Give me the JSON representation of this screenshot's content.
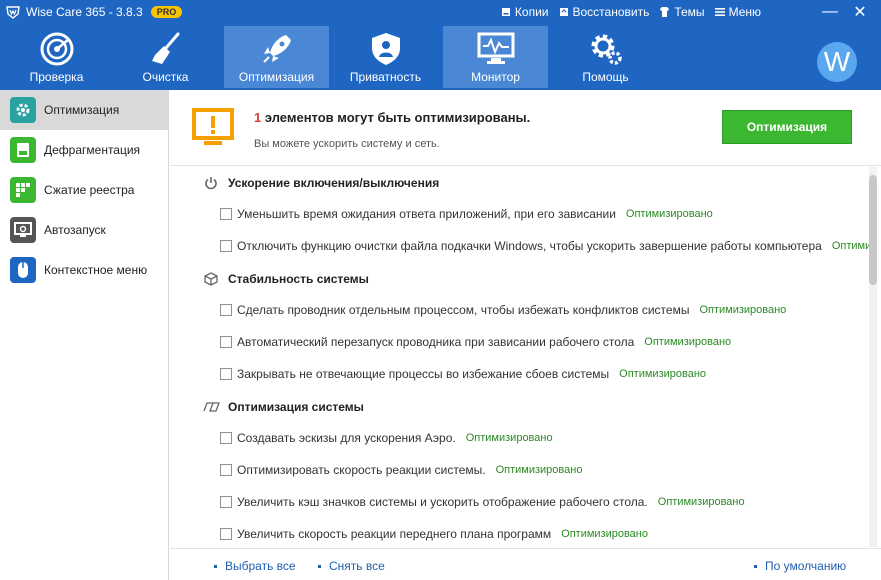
{
  "app": {
    "title": "Wise Care 365 - 3.8.3",
    "badge": "PRO",
    "menu": [
      {
        "label": "Копии",
        "icon": "disk-icon"
      },
      {
        "label": "Восстановить",
        "icon": "restore-icon"
      },
      {
        "label": "Темы",
        "icon": "shirt-icon"
      },
      {
        "label": "Меню",
        "icon": "menu-icon"
      }
    ],
    "window_controls": {
      "minimize": "—",
      "close": "✕"
    },
    "avatar_letter": "W"
  },
  "toolbar": [
    {
      "label": "Проверка",
      "icon": "radar-icon",
      "active": false
    },
    {
      "label": "Очистка",
      "icon": "broom-icon",
      "active": false
    },
    {
      "label": "Оптимизация",
      "icon": "rocket-icon",
      "active": true
    },
    {
      "label": "Приватность",
      "icon": "shield-icon",
      "active": false
    },
    {
      "label": "Монитор",
      "icon": "monitor-icon",
      "active": true
    },
    {
      "label": "Помощь",
      "icon": "gear-icon",
      "active": false
    }
  ],
  "sidebar": [
    {
      "label": "Оптимизация",
      "icon": "optimize-gear-icon",
      "color": "#2aa3a0",
      "active": true
    },
    {
      "label": "Дефрагментация",
      "icon": "defrag-icon",
      "color": "#3cb731",
      "active": false
    },
    {
      "label": "Сжатие реестра",
      "icon": "registry-icon",
      "color": "#3cb731",
      "active": false
    },
    {
      "label": "Автозапуск",
      "icon": "startup-icon",
      "color": "#555555",
      "active": false
    },
    {
      "label": "Контекстное меню",
      "icon": "mouse-icon",
      "color": "#1f66c3",
      "active": false
    }
  ],
  "header": {
    "count": "1",
    "title_rest": " элементов могут быть оптимизированы.",
    "subtitle": "Вы можете ускорить систему и сеть.",
    "button_label": "Оптимизация"
  },
  "sections": [
    {
      "title": "Ускорение включения/выключения",
      "icon": "power-icon",
      "items": [
        {
          "label": "Уменьшить время ожидания ответа приложений, при его зависании",
          "status": "Оптимизировано"
        },
        {
          "label": "Отключить функцию очистки файла подкачки Windows, чтобы ускорить завершение работы компьютера",
          "status": "Оптимизиро..."
        }
      ]
    },
    {
      "title": "Стабильность системы",
      "icon": "cube-icon",
      "items": [
        {
          "label": "Сделать проводник отдельным процессом, чтобы избежать конфликтов системы",
          "status": "Оптимизировано"
        },
        {
          "label": "Автоматический перезапуск проводника при зависании рабочего стола",
          "status": "Оптимизировано"
        },
        {
          "label": "Закрывать не отвечающие процессы во избежание сбоев системы",
          "status": "Оптимизировано"
        }
      ]
    },
    {
      "title": "Оптимизация системы",
      "icon": "3d-icon",
      "items": [
        {
          "label": "Создавать эскизы для ускорения Аэро.",
          "status": "Оптимизировано"
        },
        {
          "label": "Оптимизировать скорость реакции системы.",
          "status": "Оптимизировано"
        },
        {
          "label": "Увеличить кэш значков системы и ускорить отображение рабочего стола.",
          "status": "Оптимизировано"
        },
        {
          "label": "Увеличить скорость реакции переднего плана программ",
          "status": "Оптимизировано"
        }
      ]
    }
  ],
  "footer": {
    "select_all": "Выбрать все",
    "deselect_all": "Снять все",
    "default": "По умолчанию"
  }
}
